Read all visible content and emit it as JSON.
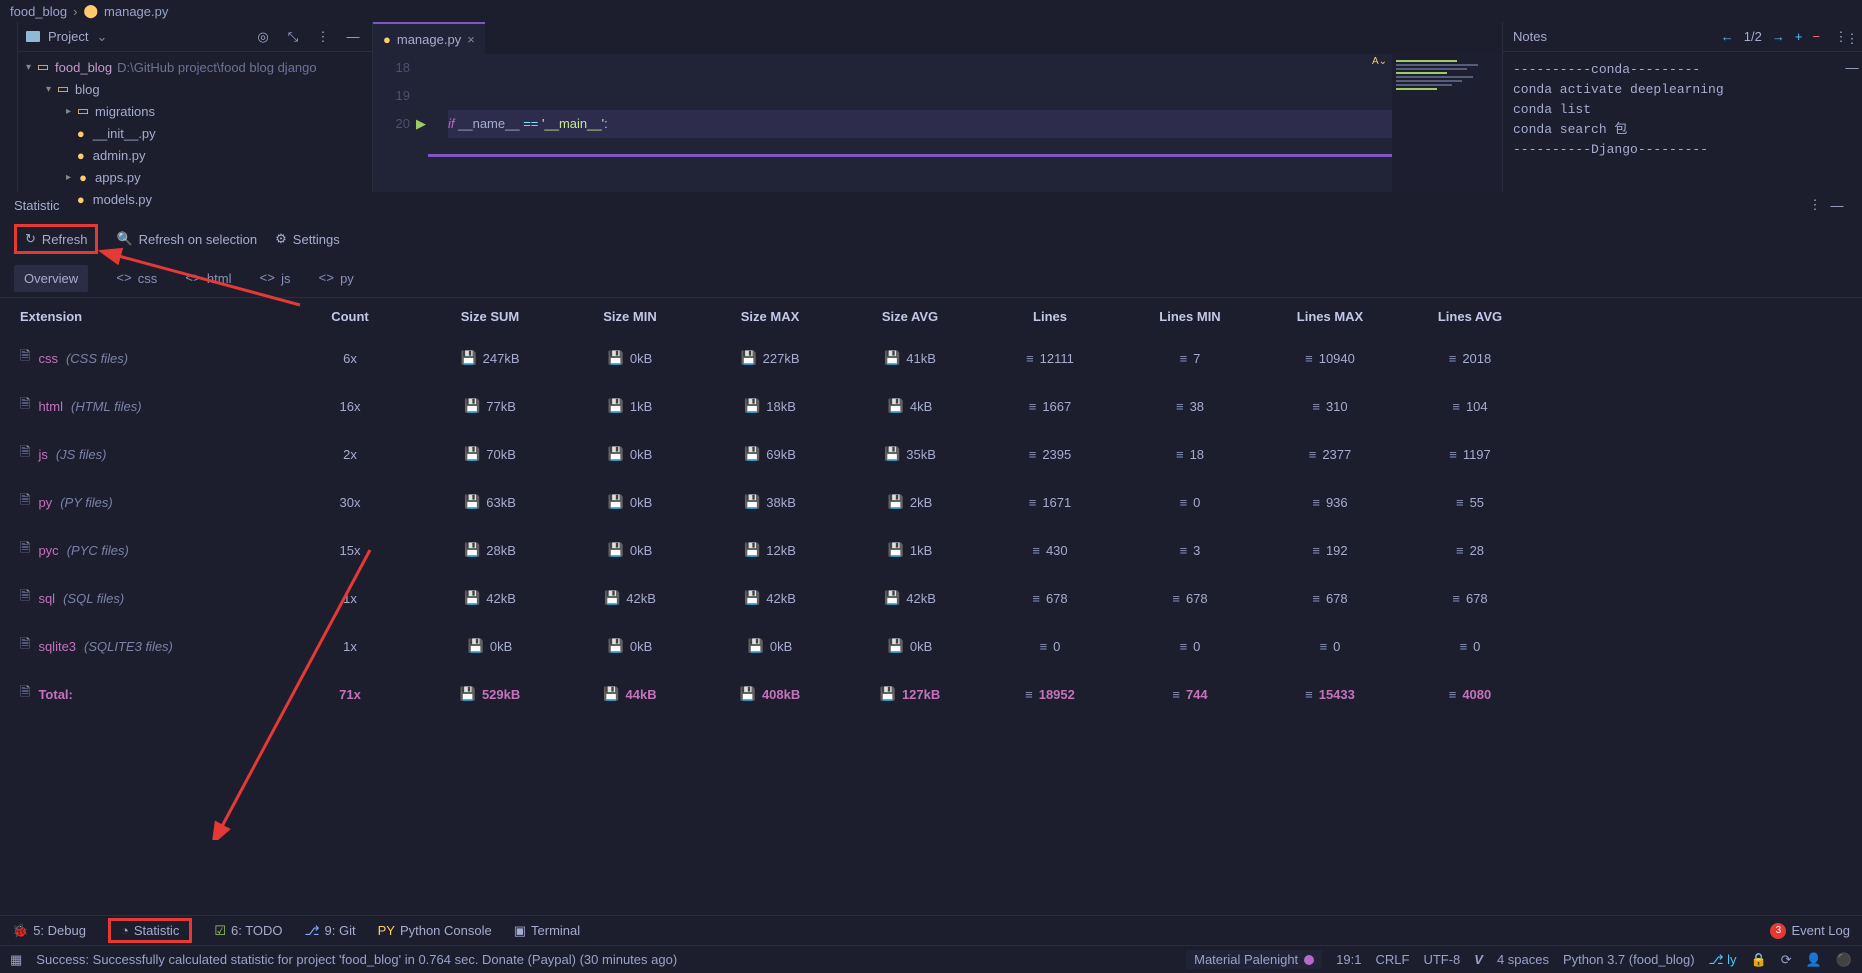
{
  "breadcrumb": {
    "project": "food_blog",
    "file": "manage.py"
  },
  "projectPane": {
    "title": "Project",
    "root": {
      "name": "food_blog",
      "path": "D:\\GitHub project\\food blog django"
    },
    "tree": [
      {
        "indent": 1,
        "caret": "▾",
        "icon": "folder",
        "label": "blog"
      },
      {
        "indent": 2,
        "caret": "▸",
        "icon": "folder",
        "label": "migrations"
      },
      {
        "indent": 2,
        "caret": "",
        "icon": "py",
        "label": "__init__.py"
      },
      {
        "indent": 2,
        "caret": "",
        "icon": "py",
        "label": "admin.py"
      },
      {
        "indent": 2,
        "caret": "▸",
        "icon": "py",
        "label": "apps.py"
      },
      {
        "indent": 2,
        "caret": "",
        "icon": "py",
        "label": "models.py"
      }
    ]
  },
  "editor": {
    "tab": "manage.py",
    "lines": [
      "18",
      "19",
      "20"
    ],
    "codeLine": {
      "kw": "if",
      "name": "__name__",
      "op": "==",
      "str": "'__main__'",
      "colon": ":"
    }
  },
  "notes": {
    "title": "Notes",
    "counter": "1/2",
    "body": "----------conda---------\nconda activate deeplearning\nconda list\nconda search 包\n----------Django---------"
  },
  "statistic": {
    "title": "Statistic",
    "toolbar": {
      "refresh": "Refresh",
      "refreshSel": "Refresh on selection",
      "settings": "Settings"
    },
    "tabs": [
      "Overview",
      "css",
      "html",
      "js",
      "py"
    ],
    "headers": [
      "Extension",
      "Count",
      "Size SUM",
      "Size MIN",
      "Size MAX",
      "Size AVG",
      "Lines",
      "Lines MIN",
      "Lines MAX",
      "Lines AVG"
    ],
    "rows": [
      {
        "ext": "css",
        "desc": "(CSS files)",
        "count": "6x",
        "sum": "247kB",
        "min": "0kB",
        "max": "227kB",
        "avg": "41kB",
        "lines": "12111",
        "lmin": "7",
        "lmax": "10940",
        "lavg": "2018"
      },
      {
        "ext": "html",
        "desc": "(HTML files)",
        "count": "16x",
        "sum": "77kB",
        "min": "1kB",
        "max": "18kB",
        "avg": "4kB",
        "lines": "1667",
        "lmin": "38",
        "lmax": "310",
        "lavg": "104"
      },
      {
        "ext": "js",
        "desc": "(JS files)",
        "count": "2x",
        "sum": "70kB",
        "min": "0kB",
        "max": "69kB",
        "avg": "35kB",
        "lines": "2395",
        "lmin": "18",
        "lmax": "2377",
        "lavg": "1197"
      },
      {
        "ext": "py",
        "desc": "(PY files)",
        "count": "30x",
        "sum": "63kB",
        "min": "0kB",
        "max": "38kB",
        "avg": "2kB",
        "lines": "1671",
        "lmin": "0",
        "lmax": "936",
        "lavg": "55"
      },
      {
        "ext": "pyc",
        "desc": "(PYC files)",
        "count": "15x",
        "sum": "28kB",
        "min": "0kB",
        "max": "12kB",
        "avg": "1kB",
        "lines": "430",
        "lmin": "3",
        "lmax": "192",
        "lavg": "28"
      },
      {
        "ext": "sql",
        "desc": "(SQL files)",
        "count": "1x",
        "sum": "42kB",
        "min": "42kB",
        "max": "42kB",
        "avg": "42kB",
        "lines": "678",
        "lmin": "678",
        "lmax": "678",
        "lavg": "678"
      },
      {
        "ext": "sqlite3",
        "desc": "(SQLITE3 files)",
        "count": "1x",
        "sum": "0kB",
        "min": "0kB",
        "max": "0kB",
        "avg": "0kB",
        "lines": "0",
        "lmin": "0",
        "lmax": "0",
        "lavg": "0"
      }
    ],
    "total": {
      "ext": "Total:",
      "count": "71x",
      "sum": "529kB",
      "min": "44kB",
      "max": "408kB",
      "avg": "127kB",
      "lines": "18952",
      "lmin": "744",
      "lmax": "15433",
      "lavg": "4080"
    }
  },
  "bottomTools": {
    "debug": "5: Debug",
    "statistic": "Statistic",
    "todo": "6: TODO",
    "git": "9: Git",
    "pyconsole": "Python Console",
    "terminal": "Terminal",
    "eventlog": "Event Log",
    "badge": "3"
  },
  "statusBar": {
    "msg": "Success: Successfully calculated statistic for project 'food_blog' in 0.764 sec. Donate (Paypal) (30 minutes ago)",
    "theme": "Material Palenight",
    "pos": "19:1",
    "eol": "CRLF",
    "enc": "UTF-8",
    "indent": "4 spaces",
    "python": "Python 3.7 (food_blog)",
    "branch": "ly"
  }
}
